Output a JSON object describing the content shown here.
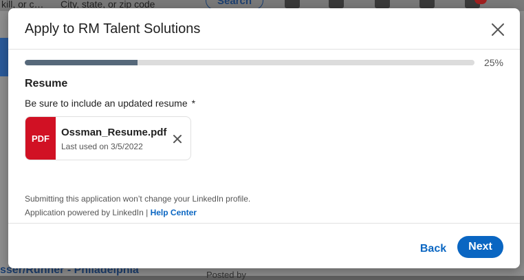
{
  "background": {
    "search_fragment": "kill, or c…",
    "location_placeholder": "City, state, or zip code",
    "search_button": "Search",
    "bottom_job_title": "sser/Runner - Philadelphia",
    "posted_by": "Posted by"
  },
  "modal": {
    "title": "Apply to RM Talent Solutions",
    "close_icon": "close-icon",
    "progress": {
      "value": 0.25,
      "label": "25%"
    },
    "section_heading": "Resume",
    "resume_description": "Be sure to include an updated resume",
    "required_mark": "*",
    "file": {
      "type_label": "PDF",
      "name": "Ossman_Resume.pdf",
      "meta": "Last used on 3/5/2022",
      "remove_icon": "close-icon"
    },
    "footnote": "Submitting this application won’t change your LinkedIn profile.",
    "powered_by": "Application powered by LinkedIn |",
    "help_link": "Help Center",
    "back_label": "Back",
    "next_label": "Next"
  },
  "colors": {
    "accent": "#0a66c2",
    "pdf": "#d11124",
    "progress_fill": "#56687a",
    "progress_track": "#dcdcdc"
  }
}
